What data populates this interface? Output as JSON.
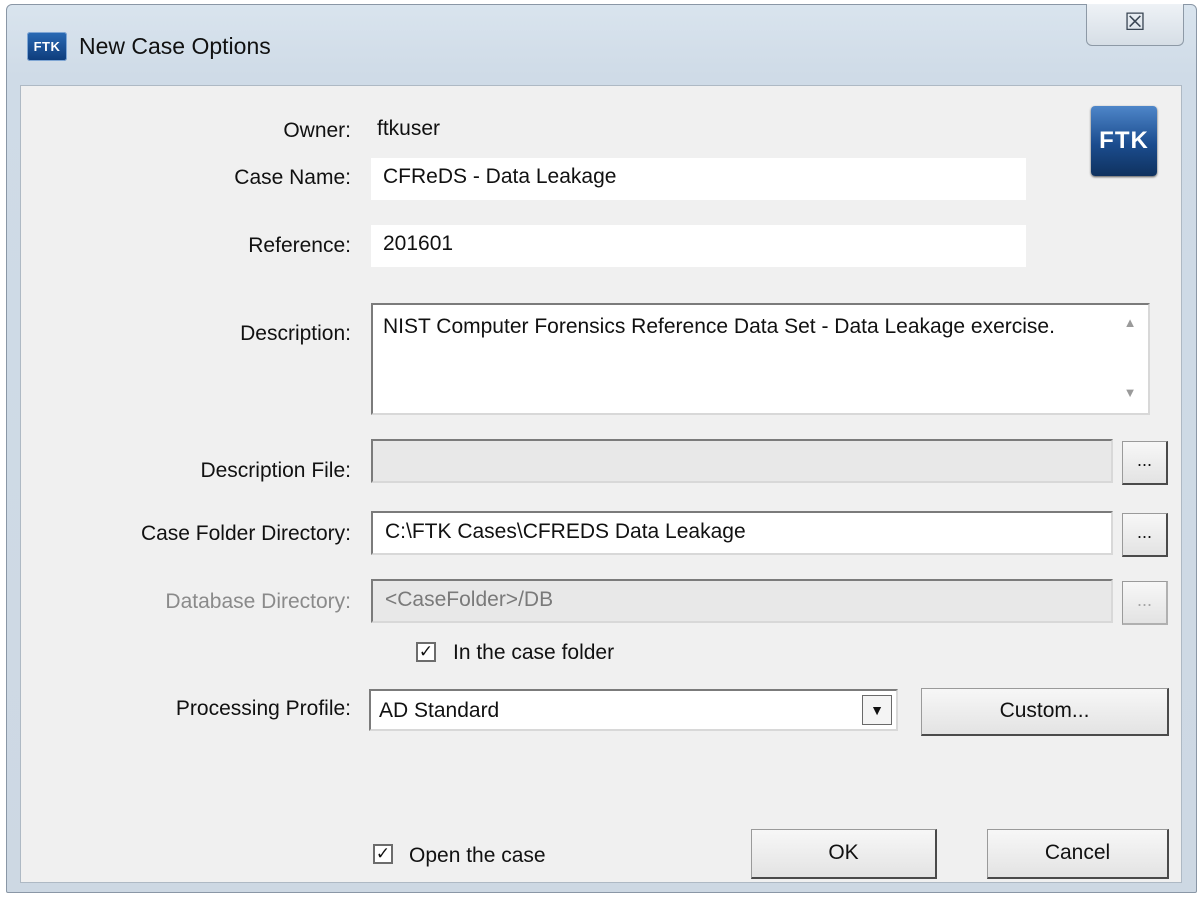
{
  "window": {
    "title": "New Case Options",
    "app_icon_text": "FTK",
    "close_symbol": "☒"
  },
  "logo": {
    "text": "FTK"
  },
  "owner": {
    "label": "Owner:",
    "value": "ftkuser"
  },
  "case_name": {
    "label": "Case Name:",
    "value": "CFReDS - Data Leakage"
  },
  "reference": {
    "label": "Reference:",
    "value": "201601"
  },
  "description": {
    "label": "Description:",
    "value": "NIST Computer Forensics Reference Data Set - Data Leakage exercise.",
    "scroll_up": "▲",
    "scroll_down": "▼"
  },
  "description_file": {
    "label": "Description File:",
    "value": "",
    "browse_label": "..."
  },
  "case_folder": {
    "label": "Case Folder Directory:",
    "value": "C:\\FTK Cases\\CFREDS Data Leakage",
    "browse_label": "..."
  },
  "database_dir": {
    "label": "Database Directory:",
    "value": "<CaseFolder>/DB",
    "browse_label": "..."
  },
  "in_case_folder": {
    "label": "In the case folder",
    "checked": true,
    "check_mark": "✓"
  },
  "processing_profile": {
    "label": "Processing Profile:",
    "value": "AD Standard",
    "arrow": "▼",
    "custom_label": "Custom..."
  },
  "open_case": {
    "label": "Open the case",
    "checked": true,
    "check_mark": "✓"
  },
  "buttons": {
    "ok": "OK",
    "cancel": "Cancel"
  }
}
